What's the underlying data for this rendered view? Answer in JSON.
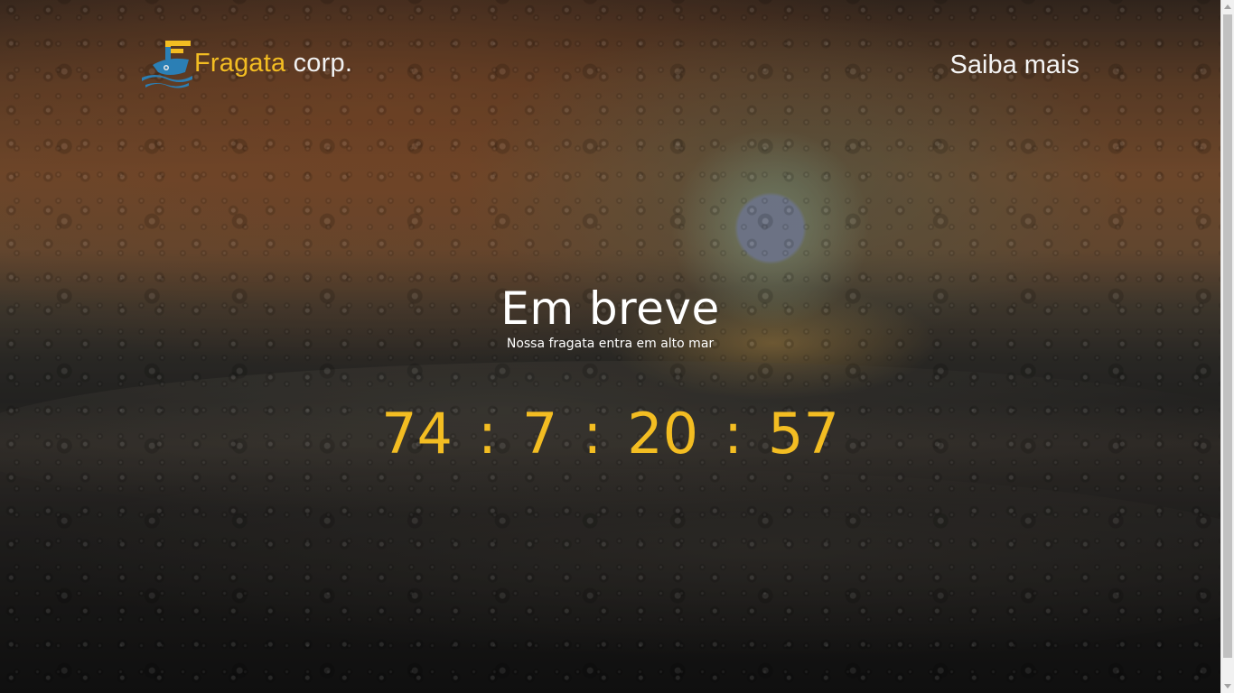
{
  "header": {
    "logo": {
      "icon": "boat-icon",
      "name": "Fragata",
      "suffix": " corp."
    },
    "nav_link": "Saiba mais"
  },
  "hero": {
    "title": "Em breve",
    "subtitle": "Nossa fragata entra em alto mar"
  },
  "countdown": {
    "days": "74",
    "hours": "7",
    "minutes": "20",
    "seconds": "57",
    "separator": ":"
  },
  "colors": {
    "accent": "#f3bd22",
    "text": "#ffffff",
    "logo_blue": "#2b7fb5"
  }
}
